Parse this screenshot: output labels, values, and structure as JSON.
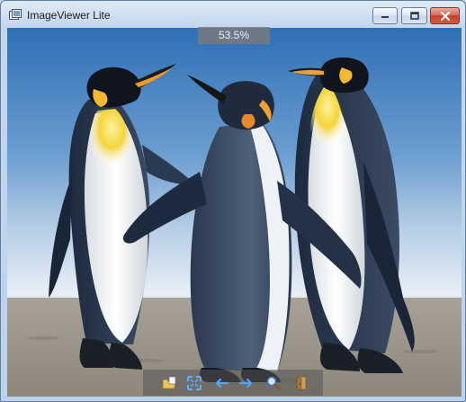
{
  "window": {
    "title": "ImageViewer Lite",
    "app_icon": "image-viewer-icon",
    "controls": [
      {
        "name": "minimize",
        "icon": "minimize-icon"
      },
      {
        "name": "maximize",
        "icon": "maximize-icon"
      },
      {
        "name": "close",
        "icon": "close-icon"
      }
    ]
  },
  "viewer": {
    "zoom_label": "53.5%",
    "image_subject": "photo-penguins"
  },
  "toolbar": {
    "buttons": [
      {
        "name": "open-folder",
        "icon": "folder-icon"
      },
      {
        "name": "fit-to-window",
        "icon": "fit-screen-icon"
      },
      {
        "name": "previous-image",
        "icon": "arrow-left-icon"
      },
      {
        "name": "next-image",
        "icon": "arrow-right-icon"
      },
      {
        "name": "zoom",
        "icon": "magnifier-icon"
      },
      {
        "name": "exit",
        "icon": "exit-door-icon"
      }
    ]
  },
  "colors": {
    "titlebar": "#c4d7ee",
    "close_button": "#c0412a",
    "overlay": "#7a7a7a"
  }
}
